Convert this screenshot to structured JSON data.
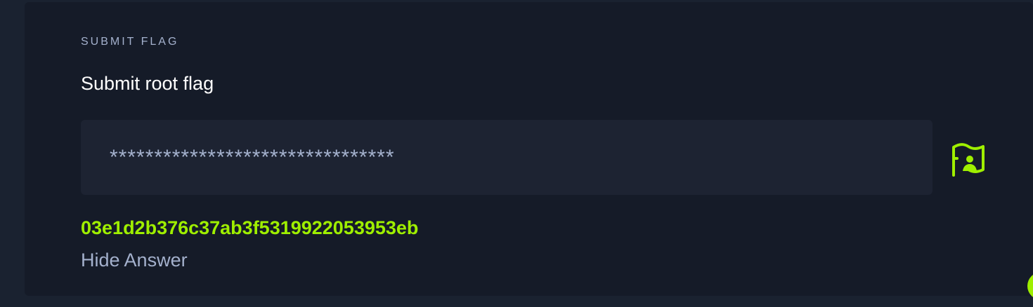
{
  "section": {
    "eyebrow": "SUBMIT FLAG",
    "title": "Submit root flag"
  },
  "flag_input": {
    "value": "********************************",
    "type": "password"
  },
  "submit": {
    "icon": "flag-user-icon"
  },
  "answer": {
    "value": "03e1d2b376c37ab3f5319922053953eb",
    "toggle_label": "Hide Answer"
  },
  "colors": {
    "background": "#1a2230",
    "card": "#151b28",
    "input_bg": "#1d2332",
    "accent": "#9fef00",
    "muted_text": "#a4b1cd",
    "title_text": "#ffffff"
  }
}
